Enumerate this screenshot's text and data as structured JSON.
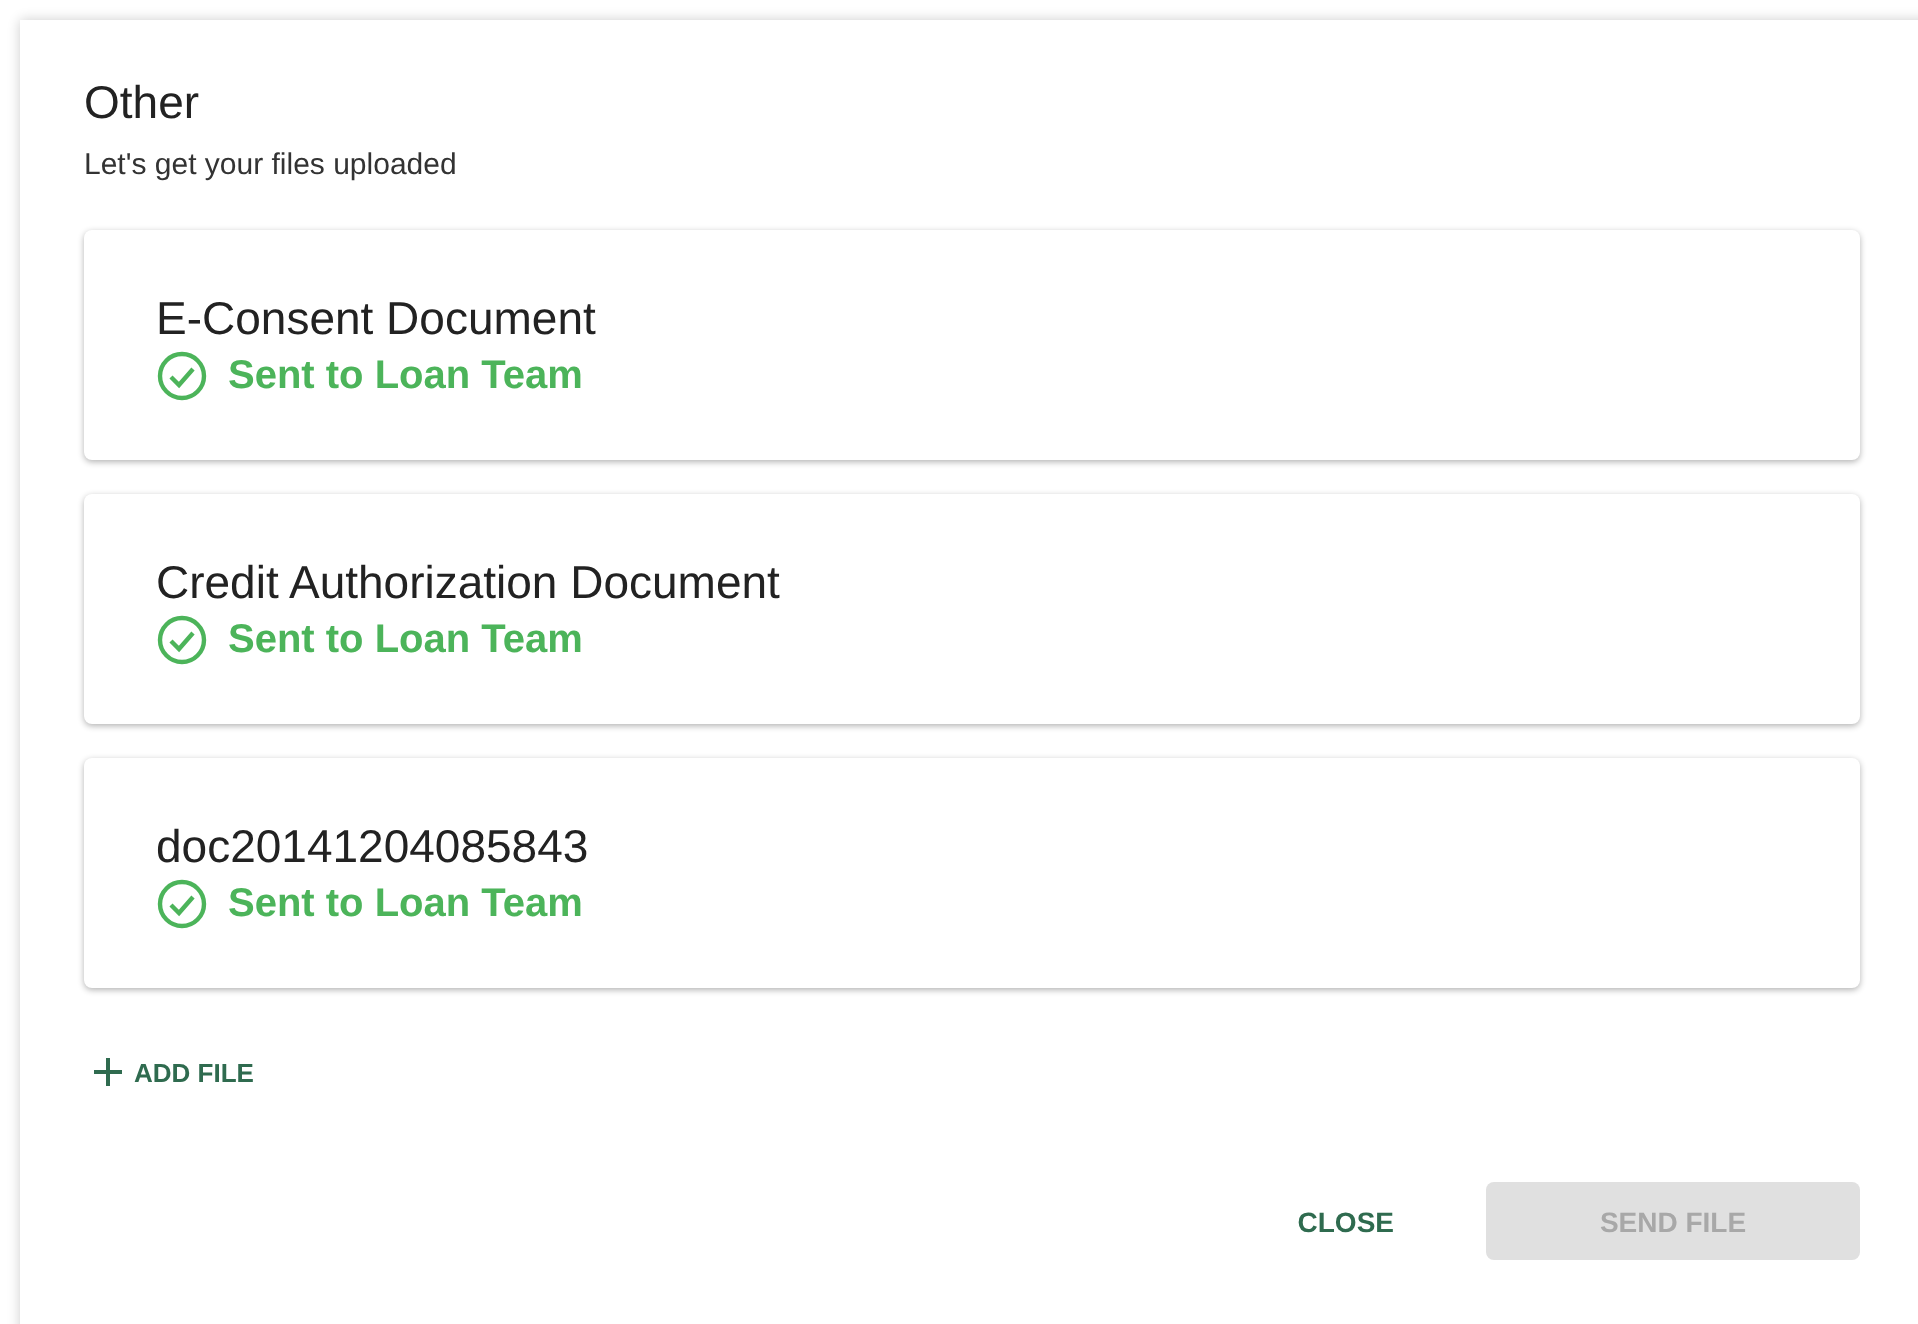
{
  "dialog": {
    "title": "Other",
    "subtitle": "Let's get your files uploaded"
  },
  "files": [
    {
      "name": "E-Consent Document",
      "status": "Sent to Loan Team",
      "sent": true
    },
    {
      "name": "Credit Authorization Document",
      "status": "Sent to Loan Team",
      "sent": true
    },
    {
      "name": "doc20141204085843",
      "status": "Sent to Loan Team",
      "sent": true
    }
  ],
  "add_button": {
    "label": "ADD FILE"
  },
  "actions": [
    {
      "label": "CLOSE",
      "kind": "text",
      "disabled": false
    },
    {
      "label": "SEND FILE",
      "kind": "filled",
      "disabled": true
    }
  ]
}
